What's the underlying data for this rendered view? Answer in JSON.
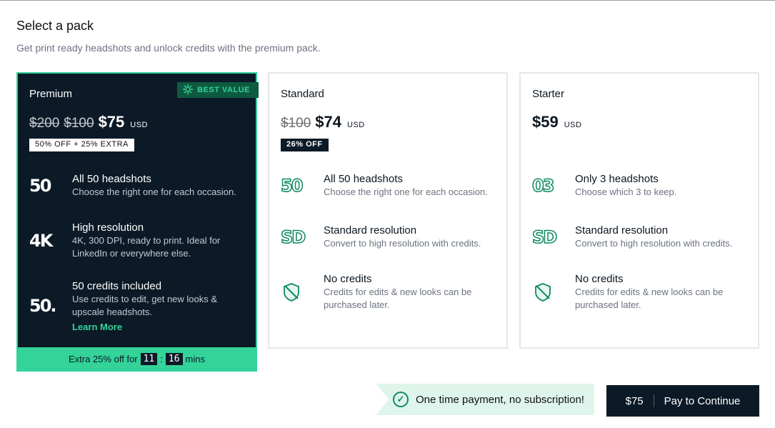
{
  "header": {
    "title": "Select a pack",
    "subtitle": "Get print ready headshots and unlock credits with the premium pack."
  },
  "colors": {
    "accent": "#34d399",
    "dark": "#0b1a26",
    "ribbon": "#dff5ec"
  },
  "premium": {
    "name": "Premium",
    "best_value": "BEST VALUE",
    "old_price_1": "$200",
    "old_price_2": "$100",
    "price": "$75",
    "currency": "USD",
    "badge": "50% OFF  + 25% EXTRA",
    "features": [
      {
        "icon": "50",
        "title": "All 50 headshots",
        "desc": "Choose the right one for each occasion."
      },
      {
        "icon": "4K",
        "title": "High resolution",
        "desc": "4K, 300 DPI, ready to print. Ideal for LinkedIn or everywhere else."
      },
      {
        "icon": "50.",
        "title": "50 credits included",
        "desc": "Use credits to edit, get new looks & upscale headshots."
      }
    ],
    "learn_more": "Learn More",
    "timer_prefix": "Extra 25% off for",
    "timer_min": "11",
    "timer_sec": "16",
    "timer_suffix": "mins",
    "timer_colon": ":"
  },
  "standard": {
    "name": "Standard",
    "old_price": "$100",
    "price": "$74",
    "currency": "USD",
    "badge": "26% OFF",
    "features": [
      {
        "icon": "50",
        "title": "All 50 headshots",
        "desc": "Choose the right one for each occasion."
      },
      {
        "icon": "SD",
        "title": "Standard resolution",
        "desc": "Convert to high resolution with credits."
      },
      {
        "icon": "no-credits-icon",
        "title": "No credits",
        "desc": "Credits for edits & new looks can be purchased later."
      }
    ]
  },
  "starter": {
    "name": "Starter",
    "price": "$59",
    "currency": "USD",
    "features": [
      {
        "icon": "03",
        "title": "Only 3 headshots",
        "desc": "Choose which 3 to keep."
      },
      {
        "icon": "SD",
        "title": "Standard resolution",
        "desc": "Convert to high resolution with credits."
      },
      {
        "icon": "no-credits-icon",
        "title": "No credits",
        "desc": "Credits for edits & new looks can be purchased later."
      }
    ]
  },
  "footer": {
    "notice": "One time payment, no subscription!",
    "pay_price": "$75",
    "pay_label": "Pay to Continue"
  }
}
